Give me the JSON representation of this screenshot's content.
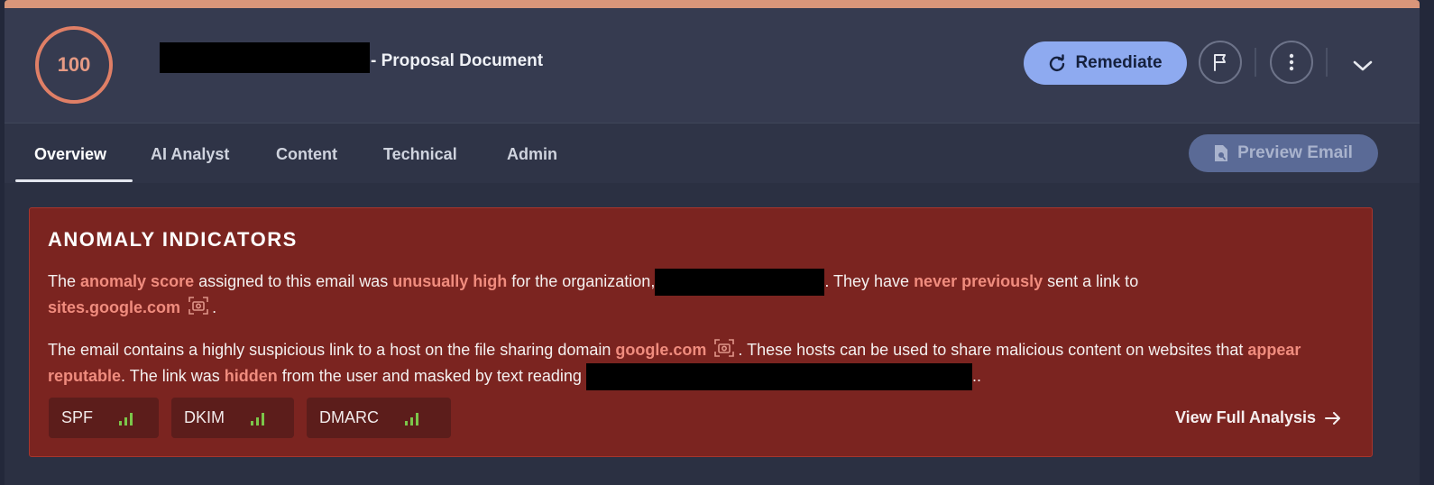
{
  "header": {
    "score": "100",
    "title": "- Proposal Document",
    "remediate_label": "Remediate",
    "icons": [
      "flag-icon",
      "more-vertical-icon",
      "chevron-down-icon"
    ]
  },
  "tabs": [
    {
      "label": "Overview",
      "active": true
    },
    {
      "label": "AI Analyst",
      "active": false
    },
    {
      "label": "Content",
      "active": false
    },
    {
      "label": "Technical",
      "active": false
    },
    {
      "label": "Admin",
      "active": false
    }
  ],
  "preview_label": "Preview Email",
  "anomaly": {
    "heading": "ANOMALY INDICATORS",
    "p1": {
      "t1": "The ",
      "h1": "anomaly score",
      "t2": " assigned to this email was ",
      "h2": "unusually high",
      "t3": " for the organization,",
      "t4": ". They have ",
      "h3": "never previously",
      "t5": " sent a link to",
      "h4": "sites.google.com",
      "t6": "."
    },
    "p2": {
      "t1": "The email contains a highly suspicious link to a host on the file sharing domain ",
      "h1": "google.com",
      "t2": ". These hosts can be used to share malicious content on websites that ",
      "h2": "appear reputable",
      "t3": ". The link was ",
      "h3": "hidden",
      "t4": " from the user and masked by text reading ",
      "t5": ".."
    },
    "badges": [
      {
        "label": "SPF",
        "status": "pass"
      },
      {
        "label": "DKIM",
        "status": "pass"
      },
      {
        "label": "DMARC",
        "status": "pass"
      }
    ],
    "view_full": "View Full Analysis"
  },
  "colors": {
    "accent_bar": "#d9967a",
    "score_ring": "#e07f66",
    "remediate_bg": "#8eaaf0",
    "alert_bg": "#7b2420",
    "highlight": "#f08c7e",
    "signal_green": "#7cc64a"
  }
}
